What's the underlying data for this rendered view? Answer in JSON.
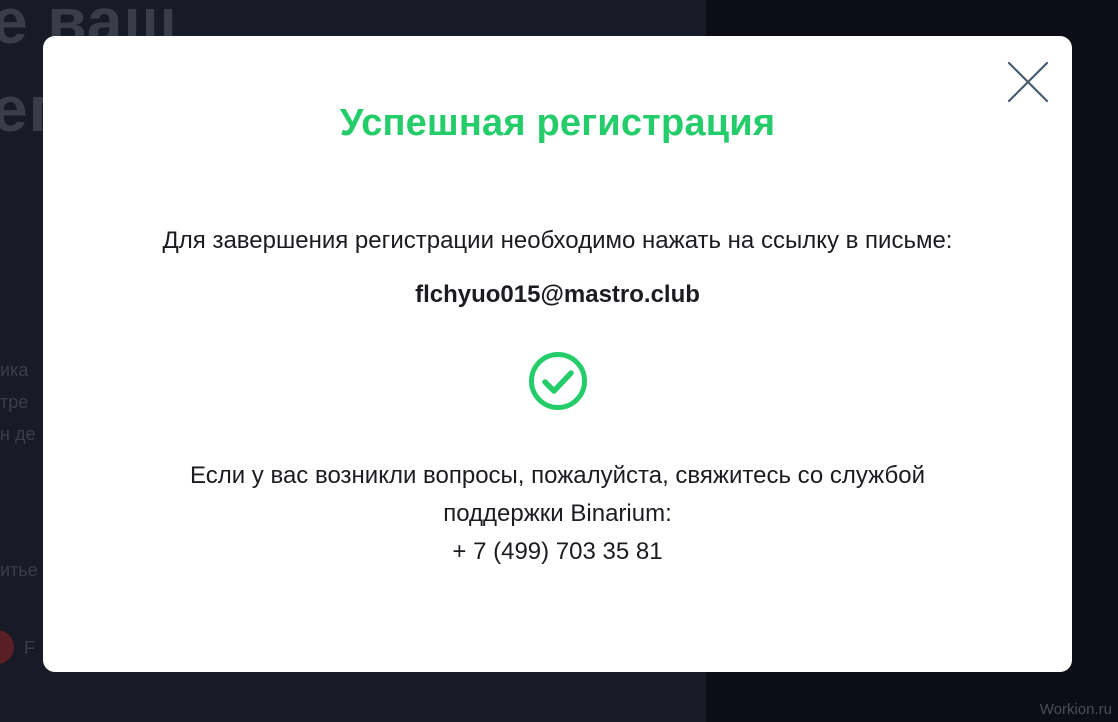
{
  "modal": {
    "title": "Успешная регистрация",
    "instruction": "Для завершения регистрации необходимо нажать на ссылку в письме:",
    "email": "flchyuo015@mastro.club",
    "support_line1": "Если у вас возникли вопросы, пожалуйста, свяжитесь со службой",
    "support_line2": "поддержки Binarium:",
    "phone": "+ 7 (499) 703 35 81"
  },
  "icons": {
    "close": "close-icon",
    "success": "checkmark-circle-icon"
  },
  "colors": {
    "accent": "#25cc6a",
    "text": "#1b1c22",
    "close_icon": "#4a5a6e",
    "backdrop": "#181a25"
  },
  "background": {
    "heading_line1": "е ваш",
    "heading_line2": "ег",
    "fragment1": "ика",
    "fragment2": "тре",
    "fragment3": "н де",
    "fragment4": "итье",
    "fragment5": "F"
  },
  "watermark": "Workion.ru"
}
